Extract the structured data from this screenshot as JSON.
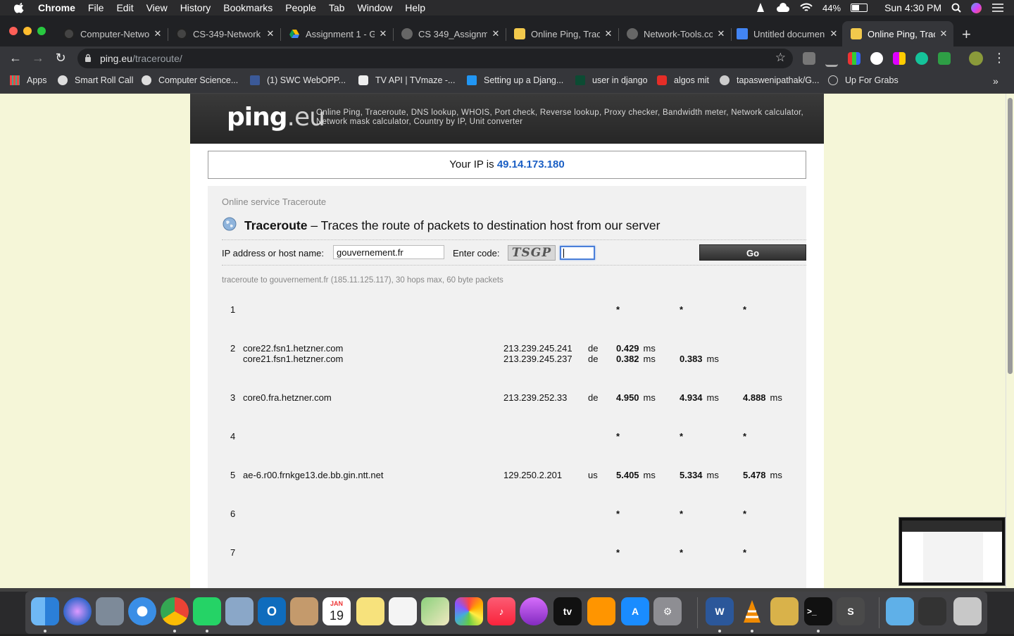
{
  "menubar": {
    "app": "Chrome",
    "items": [
      "File",
      "Edit",
      "View",
      "History",
      "Bookmarks",
      "People",
      "Tab",
      "Window",
      "Help"
    ],
    "battery": "44%",
    "clock": "Sun 4:30 PM"
  },
  "tabs": [
    {
      "label": "Computer-Netwo",
      "icon": "github-icon"
    },
    {
      "label": "CS-349-Network",
      "icon": "github-icon"
    },
    {
      "label": "Assignment 1 - Go",
      "icon": "google-drive-icon"
    },
    {
      "label": "CS 349_Assignme",
      "icon": "globe-icon"
    },
    {
      "label": "Online Ping, Trace",
      "icon": "ping-eu-icon"
    },
    {
      "label": "Network-Tools.co",
      "icon": "globe-icon"
    },
    {
      "label": "Untitled documen",
      "icon": "google-docs-icon"
    },
    {
      "label": "Online Ping, Trace",
      "icon": "ping-eu-icon",
      "active": true
    }
  ],
  "omnibox": {
    "host": "ping.eu",
    "path": "/traceroute/"
  },
  "bookmarks": [
    {
      "label": "Apps",
      "icon": "apps-grid-icon"
    },
    {
      "label": "Smart Roll Call",
      "icon": "globe-icon"
    },
    {
      "label": "Computer Science...",
      "icon": "globe-icon"
    },
    {
      "label": "(1) SWC WebOPP...",
      "icon": "facebook-icon"
    },
    {
      "label": "TV API | TVmaze -...",
      "icon": "tvmaze-icon"
    },
    {
      "label": "Setting up a Djang...",
      "icon": "bookmark-icon"
    },
    {
      "label": "user in django",
      "icon": "django-icon"
    },
    {
      "label": "algos mit",
      "icon": "youtube-icon"
    },
    {
      "label": "tapaswenipathak/G...",
      "icon": "github-icon"
    },
    {
      "label": "Up For Grabs",
      "icon": "circle-icon"
    }
  ],
  "site": {
    "logo_main": "ping",
    "logo_tld": ".eu",
    "tagline": "Online Ping, Traceroute, DNS lookup, WHOIS, Port check, Reverse lookup, Proxy checker, Bandwidth meter, Network calculator, Network mask calculator, Country by IP, Unit converter",
    "your_ip_label": "Your IP is",
    "your_ip": "49.14.173.180",
    "service_caption": "Online service Traceroute",
    "title": "Traceroute",
    "title_desc": " – Traces the route of packets to destination host from our server",
    "host_label": "IP address or host name:",
    "host_value": "gouvernement.fr",
    "code_label": "Enter code:",
    "captcha_text": "TSGP",
    "code_value": "",
    "go_label": "Go",
    "trace_header": "traceroute to gouvernement.fr (185.11.125.117), 30 hops max, 60 byte packets"
  },
  "hops": [
    {
      "num": "1",
      "lines": [
        {
          "host": "",
          "ip": "",
          "cc": "",
          "t1": "*",
          "t2": "*",
          "t3": "*"
        }
      ]
    },
    {
      "num": "2",
      "lines": [
        {
          "host": "core22.fsn1.hetzner.com",
          "ip": "213.239.245.241",
          "cc": "de",
          "t1": "0.429",
          "t2": "",
          "t3": ""
        },
        {
          "host": "core21.fsn1.hetzner.com",
          "ip": "213.239.245.237",
          "cc": "de",
          "t1": "0.382",
          "t2": "0.383",
          "t3": ""
        }
      ]
    },
    {
      "num": "3",
      "lines": [
        {
          "host": "core0.fra.hetzner.com",
          "ip": "213.239.252.33",
          "cc": "de",
          "t1": "4.950",
          "t2": "4.934",
          "t3": "4.888"
        }
      ]
    },
    {
      "num": "4",
      "lines": [
        {
          "host": "",
          "ip": "",
          "cc": "",
          "t1": "*",
          "t2": "*",
          "t3": "*"
        }
      ]
    },
    {
      "num": "5",
      "lines": [
        {
          "host": "ae-6.r00.frnkge13.de.bb.gin.ntt.net",
          "ip": "129.250.2.201",
          "cc": "us",
          "t1": "5.405",
          "t2": "5.334",
          "t3": "5.478"
        }
      ]
    },
    {
      "num": "6",
      "lines": [
        {
          "host": "",
          "ip": "",
          "cc": "",
          "t1": "*",
          "t2": "*",
          "t3": "*"
        }
      ]
    },
    {
      "num": "7",
      "lines": [
        {
          "host": "",
          "ip": "",
          "cc": "",
          "t1": "*",
          "t2": "*",
          "t3": "*"
        }
      ]
    }
  ],
  "ms_unit": "ms",
  "dock": {
    "apps": [
      "Finder",
      "Siri",
      "Launchpad",
      "Safari",
      "Chrome",
      "WhatsApp",
      "Preview",
      "Outlook",
      "Contacts",
      "Calendar",
      "Notes",
      "Reminders",
      "Maps",
      "Photos",
      "Music",
      "Podcasts",
      "TV",
      "Books",
      "App Store",
      "System Preferences",
      "Word",
      "VLC",
      "Archive Utility",
      "Terminal",
      "Sublime Text",
      "Downloads",
      "Screenshot",
      "Trash"
    ],
    "calendar_month": "JAN",
    "calendar_day": "19",
    "tv_label": "tv",
    "word_letter": "W"
  },
  "colors": {
    "accent_ip": "#1b5fc4",
    "page_bg": "#f5f6d8",
    "chrome_dark": "#202124"
  }
}
